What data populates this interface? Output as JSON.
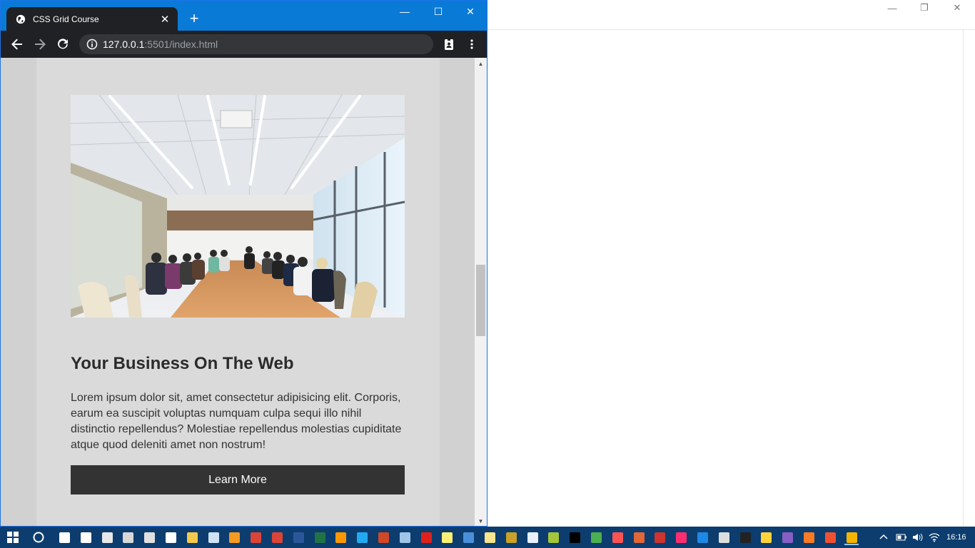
{
  "browser": {
    "tab_title": "CSS Grid Course",
    "tab_close": "✕",
    "new_tab": "+",
    "url_host": "127.0.0.1",
    "url_path": ":5501/index.html"
  },
  "page": {
    "heading": "Your Business On The Web",
    "body": "Lorem ipsum dolor sit, amet consectetur adipisicing elit. Corporis, earum ea suscipit voluptas numquam culpa sequi illo nihil distinctio repellendus? Molestiae repellendus molestias cupiditate atque quod deleniti amet non nostrum!",
    "button_label": "Learn More"
  },
  "taskbar": {
    "clock": "16:16",
    "apps": [
      {
        "name": "task-view",
        "color": "#ffffff"
      },
      {
        "name": "mail",
        "color": "#ffffff"
      },
      {
        "name": "paint",
        "color": "#e8e8e8"
      },
      {
        "name": "snip",
        "color": "#d8d8d8"
      },
      {
        "name": "calculator",
        "color": "#e0e0e0"
      },
      {
        "name": "settings",
        "color": "#ffffff"
      },
      {
        "name": "file-explorer",
        "color": "#f2c94c"
      },
      {
        "name": "notepad",
        "color": "#cfe3f5"
      },
      {
        "name": "media-player",
        "color": "#f59a23"
      },
      {
        "name": "chrome-1",
        "color": "#db4437"
      },
      {
        "name": "chrome-2",
        "color": "#db4437"
      },
      {
        "name": "word",
        "color": "#2b579a"
      },
      {
        "name": "excel",
        "color": "#217346"
      },
      {
        "name": "sublime",
        "color": "#ff9800"
      },
      {
        "name": "vscode",
        "color": "#23a9f2"
      },
      {
        "name": "powerpoint",
        "color": "#d24726"
      },
      {
        "name": "remote-desktop",
        "color": "#9fc5e8"
      },
      {
        "name": "acrobat",
        "color": "#e0201b"
      },
      {
        "name": "sticky-notes",
        "color": "#fff176"
      },
      {
        "name": "network-tool",
        "color": "#4a90d9"
      },
      {
        "name": "notes",
        "color": "#f8e58c"
      },
      {
        "name": "registry",
        "color": "#c9a227"
      },
      {
        "name": "puzzle-app",
        "color": "#e8f1fb"
      },
      {
        "name": "android",
        "color": "#a4c639"
      },
      {
        "name": "intellij",
        "color": "#000000"
      },
      {
        "name": "green-app",
        "color": "#4caf50"
      },
      {
        "name": "red-app",
        "color": "#ff5252"
      },
      {
        "name": "matlab",
        "color": "#e16737"
      },
      {
        "name": "ruby",
        "color": "#cc342d"
      },
      {
        "name": "pink-app",
        "color": "#ff2d6f"
      },
      {
        "name": "doc-app",
        "color": "#1e88e5"
      },
      {
        "name": "printer",
        "color": "#dddddd"
      },
      {
        "name": "cmd",
        "color": "#222222"
      },
      {
        "name": "python",
        "color": "#ffd43b"
      },
      {
        "name": "visual-studio",
        "color": "#865fc5"
      },
      {
        "name": "xampp",
        "color": "#fb7a24"
      },
      {
        "name": "git",
        "color": "#f05133"
      },
      {
        "name": "chrome-active",
        "color": "#f4b400"
      }
    ]
  }
}
